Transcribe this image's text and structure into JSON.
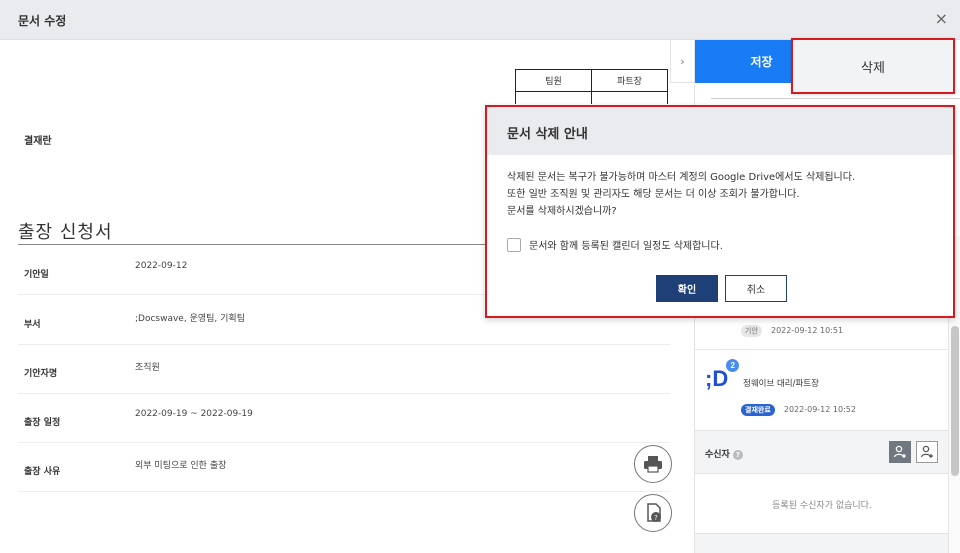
{
  "window": {
    "title": "문서 수정",
    "close_symbol": "×"
  },
  "document": {
    "approval_label": "결재란",
    "approval_headers": [
      "팀원",
      "파트장"
    ],
    "title": "출장 신청서",
    "fields": [
      {
        "label": "기안일",
        "value": "2022-09-12"
      },
      {
        "label": "부서",
        "value": ";Docswave, 운영팀, 기획팀"
      },
      {
        "label": "기안자명",
        "value": "조직원"
      },
      {
        "label": "출장 일정",
        "value": "2022-09-19 ~ 2022-09-19"
      },
      {
        "label": "출장 사유",
        "value": "외부 미팅으로 인한 출장"
      }
    ]
  },
  "sidebar": {
    "toggle_symbol": "›",
    "save_label": "저장",
    "delete_label": "삭제",
    "approvers": [
      {
        "badge": "기안",
        "time": "2022-09-12 10:51"
      },
      {
        "name": "정웨이브 대리/파트장",
        "badge": "결재완료",
        "time": "2022-09-12 10:52",
        "logo_text": ";D",
        "logo_sup": "2"
      }
    ],
    "recipients": {
      "label": "수신자",
      "help": "?",
      "empty_text": "등록된 수신자가 없습니다."
    }
  },
  "modal": {
    "title": "문서 삭제 안내",
    "lines": [
      "삭제된 문서는 복구가 불가능하며 마스터 계정의 Google Drive에서도 삭제됩니다.",
      "또한 일반 조직원 및 관리자도 해당 문서는 더 이상 조회가 불가합니다.",
      "문서를 삭제하시겠습니까?"
    ],
    "checkbox_label": "문서와 함께 등록된 캘린더 일정도 삭제합니다.",
    "checkbox_checked": false,
    "confirm_label": "확인",
    "cancel_label": "취소"
  },
  "colors": {
    "primary": "#1a7cf5",
    "highlight": "#d71920",
    "confirm": "#1f3f77",
    "badge_blue": "#2a63d6"
  }
}
